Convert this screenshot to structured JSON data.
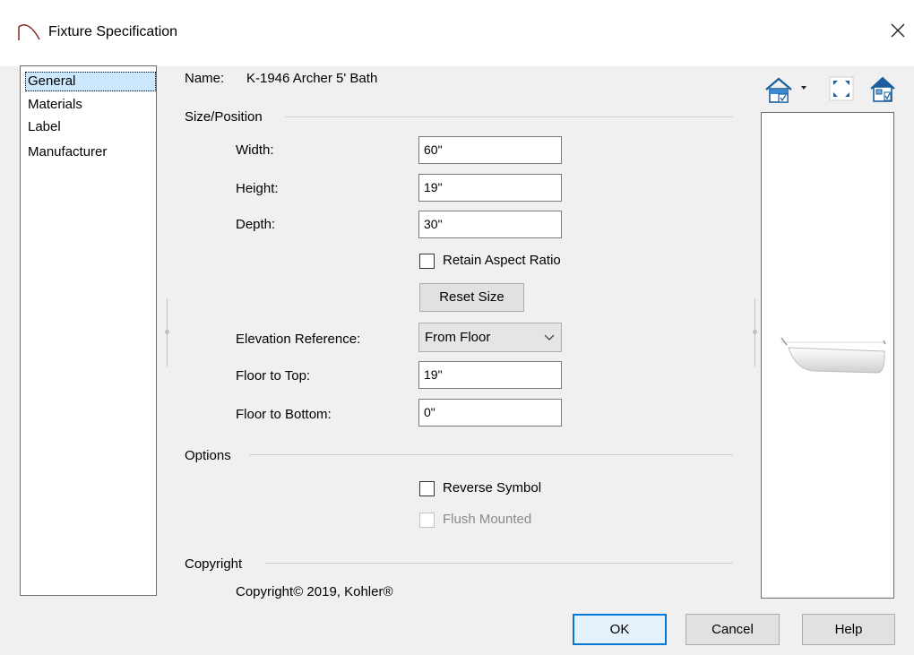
{
  "window": {
    "title": "Fixture Specification"
  },
  "nav": {
    "items": [
      "General",
      "Materials",
      "Label",
      "Manufacturer"
    ]
  },
  "name_row": {
    "label": "Name:",
    "value": "K-1946  Archer 5' Bath"
  },
  "size_position": {
    "heading": "Size/Position",
    "width_label": "Width:",
    "width_value": "60\"",
    "height_label": "Height:",
    "height_value": "19\"",
    "depth_label": "Depth:",
    "depth_value": "30\"",
    "retain_label": "Retain Aspect Ratio",
    "reset_label": "Reset Size",
    "elev_label": "Elevation Reference:",
    "elev_value": "From Floor",
    "top_label": "Floor to Top:",
    "top_value": "19\"",
    "bottom_label": "Floor to Bottom:",
    "bottom_value": "0\""
  },
  "options": {
    "heading": "Options",
    "reverse_label": "Reverse Symbol",
    "flush_label": "Flush Mounted"
  },
  "copyright": {
    "heading": "Copyright",
    "text": "Copyright© 2019, Kohler®"
  },
  "footer": {
    "ok_label": "OK",
    "cancel_label": "Cancel",
    "help_label": "Help"
  },
  "icons": {
    "title": "arc-icon",
    "close": "close-icon",
    "view_dropdown": "house-view-dropdown-icon",
    "fit": "fit-view-icon",
    "render": "render-preview-icon"
  },
  "colors": {
    "accent": "#0078d7",
    "selection": "#cce8ff",
    "icon_blue": "#1b5f9e"
  }
}
